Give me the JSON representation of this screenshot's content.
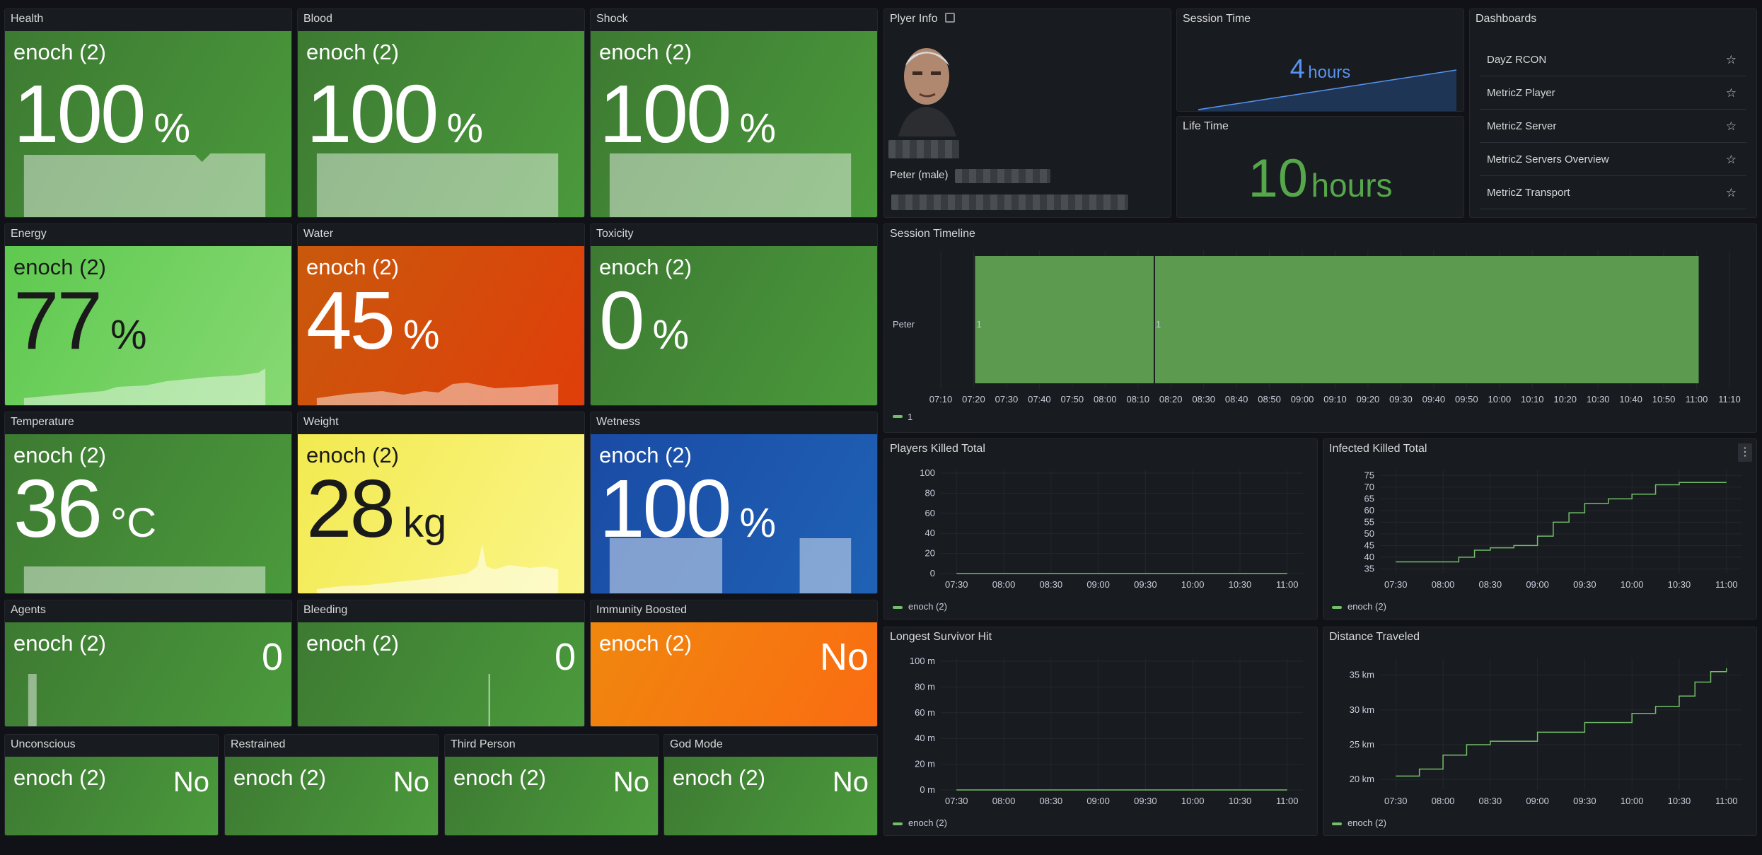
{
  "series_label": "enoch (2)",
  "stats": {
    "health": {
      "title": "Health",
      "value": "100",
      "unit": "%"
    },
    "blood": {
      "title": "Blood",
      "value": "100",
      "unit": "%"
    },
    "shock": {
      "title": "Shock",
      "value": "100",
      "unit": "%"
    },
    "energy": {
      "title": "Energy",
      "value": "77",
      "unit": "%"
    },
    "water": {
      "title": "Water",
      "value": "45",
      "unit": "%"
    },
    "toxicity": {
      "title": "Toxicity",
      "value": "0",
      "unit": "%"
    },
    "temperature": {
      "title": "Temperature",
      "value": "36",
      "unit": "°C"
    },
    "weight": {
      "title": "Weight",
      "value": "28",
      "unit": "kg"
    },
    "wetness": {
      "title": "Wetness",
      "value": "100",
      "unit": "%"
    },
    "agents": {
      "title": "Agents",
      "value": "0"
    },
    "bleeding": {
      "title": "Bleeding",
      "value": "0"
    },
    "immunity": {
      "title": "Immunity Boosted",
      "value": "No"
    },
    "unconscious": {
      "title": "Unconscious",
      "value": "No"
    },
    "restrained": {
      "title": "Restrained",
      "value": "No"
    },
    "third_person": {
      "title": "Third Person",
      "value": "No"
    },
    "god_mode": {
      "title": "God Mode",
      "value": "No"
    }
  },
  "player_info": {
    "title": "Plyer Info",
    "name": "Peter (male)"
  },
  "session_time": {
    "title": "Session Time",
    "value": "4",
    "unit": "hours"
  },
  "life_time": {
    "title": "Life Time",
    "value": "10",
    "unit": "hours"
  },
  "dashboards": {
    "title": "Dashboards",
    "items": [
      "DayZ RCON",
      "MetricZ Player",
      "MetricZ Server",
      "MetricZ Servers Overview",
      "MetricZ Transport"
    ]
  },
  "colors": {
    "green": "#4b9a3c",
    "orange": "#e03e0a",
    "yellow": "#f2ea50",
    "blue": "#1f62b5",
    "series": "#73bf69",
    "accent_blue": "#5794f2"
  },
  "chart_data": [
    {
      "type": "timeline",
      "title": "Session Timeline",
      "row_label": "Peter",
      "segment_labels": [
        "1",
        "1"
      ],
      "x_ticks": [
        "07:10",
        "07:20",
        "07:30",
        "07:40",
        "07:50",
        "08:00",
        "08:10",
        "08:20",
        "08:30",
        "08:40",
        "08:50",
        "09:00",
        "09:10",
        "09:20",
        "09:30",
        "09:40",
        "09:50",
        "10:00",
        "10:10",
        "10:20",
        "10:30",
        "10:40",
        "10:50",
        "11:00",
        "11:10"
      ],
      "legend": [
        "1"
      ]
    },
    {
      "type": "line",
      "title": "Players Killed Total",
      "x_ticks": [
        "07:30",
        "08:00",
        "08:30",
        "09:00",
        "09:30",
        "10:00",
        "10:30",
        "11:00"
      ],
      "y_ticks": [
        "0",
        "20",
        "40",
        "60",
        "80",
        "100"
      ],
      "ylim": [
        0,
        100
      ],
      "series": [
        {
          "name": "enoch (2)",
          "x": [
            "07:30",
            "11:00"
          ],
          "y": [
            0,
            0
          ]
        }
      ]
    },
    {
      "type": "line",
      "title": "Infected Killed Total",
      "x_ticks": [
        "07:30",
        "08:00",
        "08:30",
        "09:00",
        "09:30",
        "10:00",
        "10:30",
        "11:00"
      ],
      "y_ticks": [
        "35",
        "40",
        "45",
        "50",
        "55",
        "60",
        "65",
        "70",
        "75"
      ],
      "ylim": [
        33,
        76
      ],
      "series": [
        {
          "name": "enoch (2)",
          "x": [
            "07:30",
            "08:00",
            "08:10",
            "08:20",
            "08:30",
            "08:45",
            "09:00",
            "09:10",
            "09:20",
            "09:30",
            "09:45",
            "10:00",
            "10:15",
            "10:30",
            "11:00"
          ],
          "y": [
            38,
            38,
            40,
            43,
            44,
            45,
            49,
            55,
            59,
            63,
            65,
            67,
            71,
            72,
            72
          ]
        }
      ]
    },
    {
      "type": "line",
      "title": "Longest Survivor Hit",
      "x_ticks": [
        "07:30",
        "08:00",
        "08:30",
        "09:00",
        "09:30",
        "10:00",
        "10:30",
        "11:00"
      ],
      "y_ticks": [
        "0 m",
        "20 m",
        "40 m",
        "60 m",
        "80 m",
        "100 m"
      ],
      "ylim": [
        0,
        100
      ],
      "series": [
        {
          "name": "enoch (2)",
          "x": [
            "07:30",
            "11:00"
          ],
          "y": [
            0,
            0
          ]
        }
      ]
    },
    {
      "type": "line",
      "title": "Distance Traveled",
      "x_ticks": [
        "07:30",
        "08:00",
        "08:30",
        "09:00",
        "09:30",
        "10:00",
        "10:30",
        "11:00"
      ],
      "y_ticks": [
        "20 km",
        "25 km",
        "30 km",
        "35 km"
      ],
      "ylim": [
        18.5,
        37
      ],
      "series": [
        {
          "name": "enoch (2)",
          "x": [
            "07:30",
            "07:45",
            "08:00",
            "08:15",
            "08:30",
            "09:00",
            "09:30",
            "10:00",
            "10:15",
            "10:30",
            "10:40",
            "10:50",
            "11:00"
          ],
          "y": [
            20.5,
            21.5,
            23.5,
            25,
            25.5,
            26.8,
            28.2,
            29.5,
            30.5,
            32,
            34,
            35.5,
            36
          ]
        }
      ]
    }
  ]
}
